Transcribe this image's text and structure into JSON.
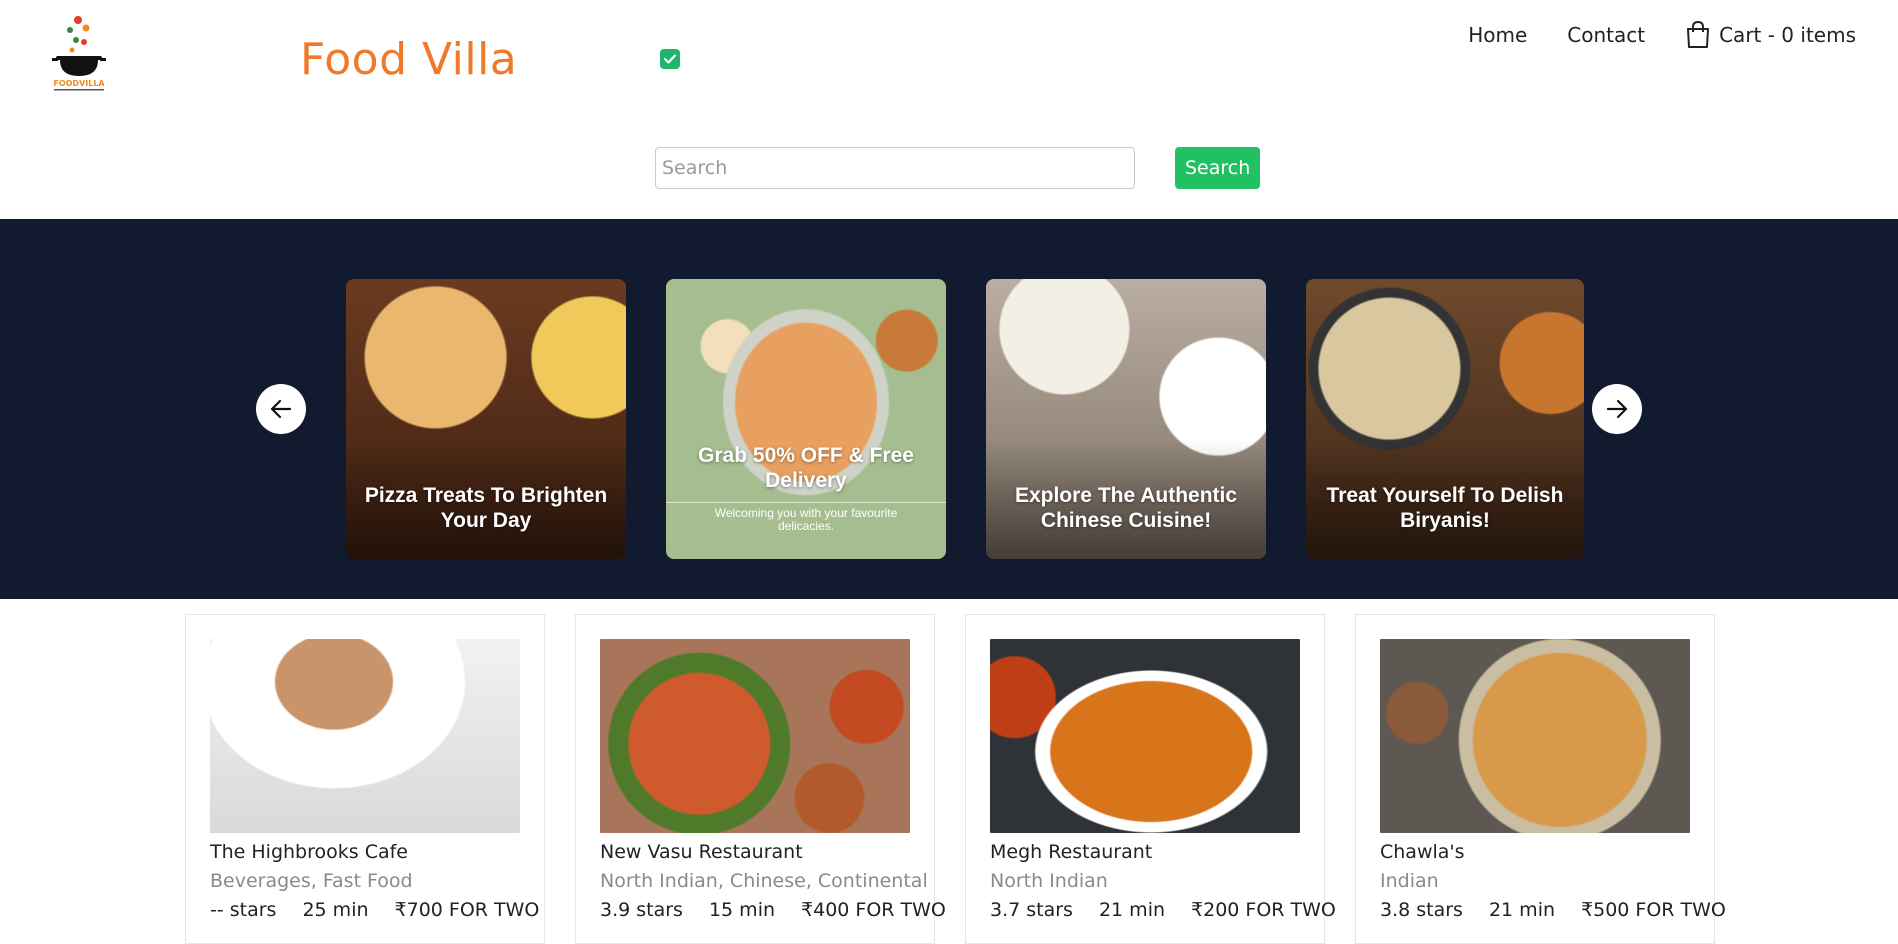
{
  "brand": {
    "title": "Food Villa",
    "logo_icon": "pot-logo-icon",
    "logo_text": "FOODVILLA"
  },
  "toggle": {
    "checked": true
  },
  "nav": {
    "home": "Home",
    "contact": "Contact",
    "cart": "Cart - 0 items"
  },
  "search": {
    "placeholder": "Search",
    "value": "",
    "button": "Search"
  },
  "carousel": {
    "slides": [
      {
        "title": "Pizza Treats To Brighten Your Day",
        "subtitle": ""
      },
      {
        "title": "Grab 50% OFF & Free Delivery",
        "subtitle": "Welcoming you with your favourite delicacies."
      },
      {
        "title": "Explore The Authentic Chinese Cuisine!",
        "subtitle": ""
      },
      {
        "title": "Treat Yourself To Delish Biryanis!",
        "subtitle": ""
      }
    ]
  },
  "restaurants": [
    {
      "name": "The Highbrooks Cafe",
      "cuisine": "Beverages, Fast Food",
      "rating": "-- stars",
      "time": "25 min",
      "cost": "₹700 FOR TWO"
    },
    {
      "name": "New Vasu Restaurant",
      "cuisine": "North Indian, Chinese, Continental",
      "rating": "3.9 stars",
      "time": "15 min",
      "cost": "₹400 FOR TWO"
    },
    {
      "name": "Megh Restaurant",
      "cuisine": "North Indian",
      "rating": "3.7 stars",
      "time": "21 min",
      "cost": "₹200 FOR TWO"
    },
    {
      "name": "Chawla's",
      "cuisine": "Indian",
      "rating": "3.8 stars",
      "time": "21 min",
      "cost": "₹500 FOR TWO"
    }
  ],
  "colors": {
    "brand": "#ef7a2a",
    "accent": "#21c063",
    "banner": "#111a2e"
  }
}
